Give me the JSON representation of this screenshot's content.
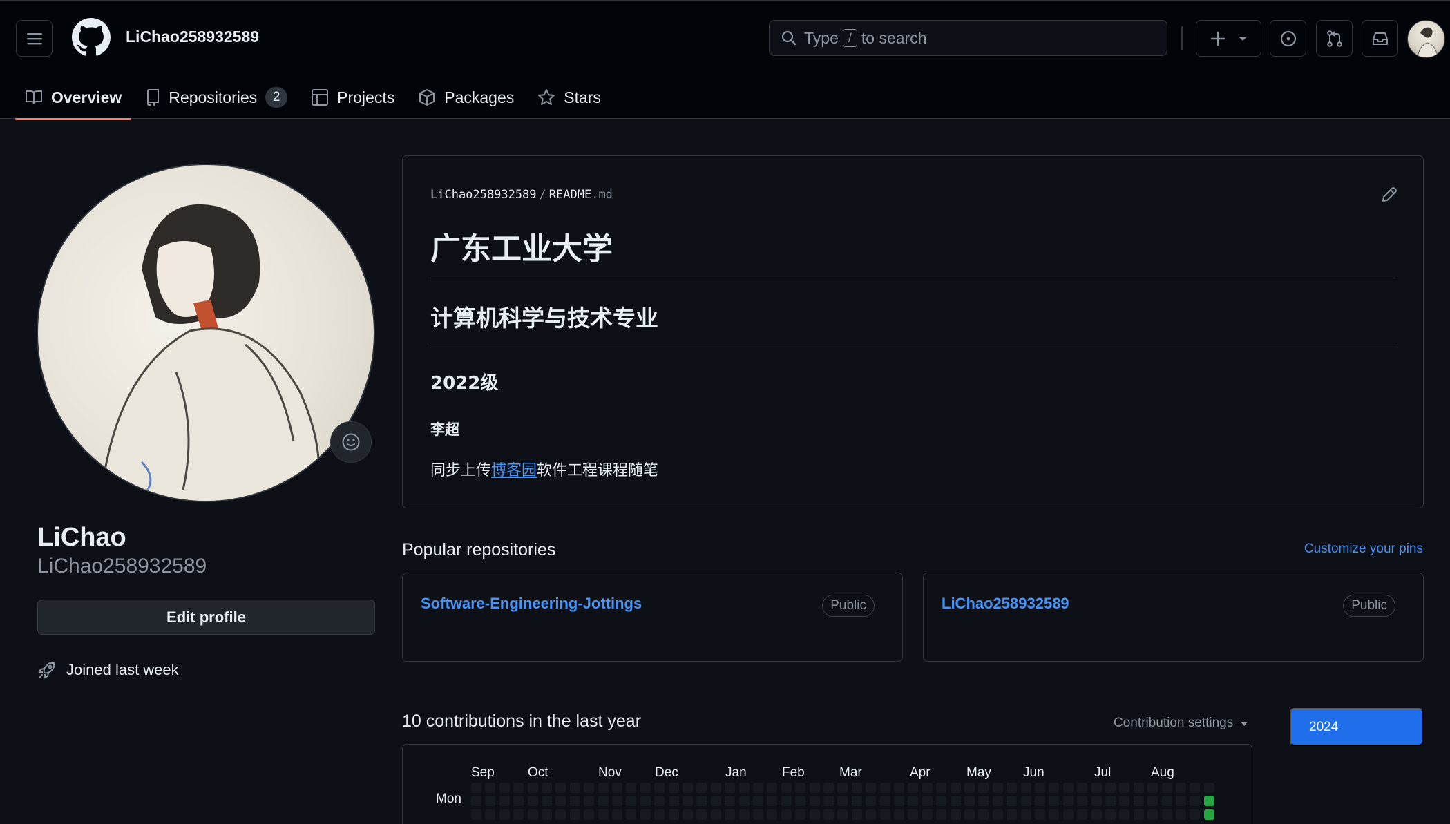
{
  "header": {
    "owner": "LiChao258932589",
    "search_prefix": "Type",
    "search_slash": "/",
    "search_suffix": "to search",
    "icons": [
      "menu-icon",
      "github-logo",
      "search-icon",
      "plus-icon",
      "triangle-down-icon",
      "issue-opened-icon",
      "git-pull-request-icon",
      "inbox-icon"
    ]
  },
  "tabs": [
    {
      "label": "Overview",
      "icon": "book-icon",
      "active": true
    },
    {
      "label": "Repositories",
      "icon": "repo-icon",
      "count": "2"
    },
    {
      "label": "Projects",
      "icon": "table-icon"
    },
    {
      "label": "Packages",
      "icon": "package-icon"
    },
    {
      "label": "Stars",
      "icon": "star-icon"
    }
  ],
  "profile": {
    "display_name": "LiChao",
    "login": "LiChao258932589",
    "edit_label": "Edit profile",
    "joined": "Joined last week"
  },
  "readme": {
    "path_owner": "LiChao258932589",
    "path_sep": "/",
    "path_file": "README",
    "path_ext": ".md",
    "h1": "广东工业大学",
    "h2": "计算机科学与技术专业",
    "h3": "2022级",
    "h4": "李超",
    "para_before": "同步上传",
    "para_link": "博客园",
    "para_after": "软件工程课程随笔"
  },
  "popular": {
    "title": "Popular repositories",
    "customize": "Customize your pins",
    "repos": [
      {
        "name": "Software-Engineering-Jottings",
        "visibility": "Public"
      },
      {
        "name": "LiChao258932589",
        "visibility": "Public"
      }
    ]
  },
  "contributions": {
    "title": "10 contributions in the last year",
    "settings": "Contribution settings",
    "year": "2024",
    "months": [
      "Sep",
      "Oct",
      "Nov",
      "Dec",
      "Jan",
      "Feb",
      "Mar",
      "Apr",
      "May",
      "Jun",
      "Jul",
      "Aug"
    ],
    "day_label": "Mon",
    "colors": {
      "empty": "#161b22",
      "level": "#26a641"
    }
  }
}
